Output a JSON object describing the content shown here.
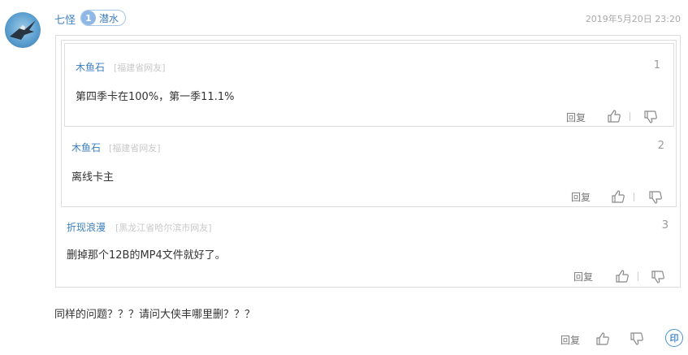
{
  "comment": {
    "username": "七怪",
    "level": "1",
    "level_title": "潜水",
    "timestamp": "2019年5月20日 23:20",
    "text": "同样的问题？？？请问大侠丰哪里删？？？",
    "reply_label": "回复",
    "emoji_label": "印"
  },
  "quotes": [
    {
      "user": "木鱼石",
      "location": "[福建省网友]",
      "floor": "1",
      "text": "第四季卡在100%，第一季11.1%",
      "reply_label": "回复"
    },
    {
      "user": "木鱼石",
      "location": "[福建省网友]",
      "floor": "2",
      "text": "离线卡主",
      "reply_label": "回复"
    },
    {
      "user": "折现浪漫",
      "location": "[黑龙江省哈尔滨市网友]",
      "floor": "3",
      "text": "删掉那个12B的MP4文件就好了。",
      "reply_label": "回复"
    }
  ],
  "icons": {
    "like": "thumbs-up-icon",
    "dislike": "thumbs-down-icon",
    "avatar": "eagle-avatar"
  },
  "colors": {
    "link": "#3c7ebf",
    "muted": "#aaaaaa",
    "border": "#dddddd",
    "badge": "#8fb8e6"
  }
}
